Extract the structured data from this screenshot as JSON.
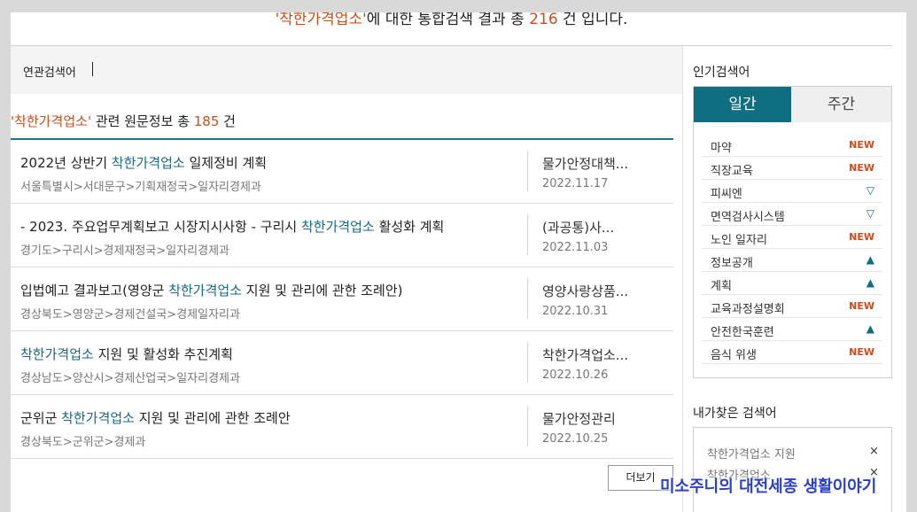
{
  "summary": {
    "quote_open": "'",
    "keyword": "착한가격업소",
    "quote_close": "'",
    "text_mid": "에 대한 통합검색 결과 총 ",
    "total": "216",
    "text_end": " 건 입니다."
  },
  "related": {
    "label": "연관검색어"
  },
  "count_line": {
    "quote_open": "'",
    "keyword": "착한가격업소",
    "quote_close": "'",
    "text_mid": " 관련 원문정보 총 ",
    "count": "185",
    "text_end": " 건"
  },
  "results": [
    {
      "pre": "2022년 상반기 ",
      "hl": "착한가격업소",
      "post": " 일제정비 계획",
      "path": "서울특별시>서대문구>기획재정국>일자리경제과",
      "org": "물가안정대책...",
      "date": "2022.11.17"
    },
    {
      "pre": "- 2023. 주요업무계획보고 시장지시사항 - 구리시 ",
      "hl": "착한가격업소",
      "post": " 활성화 계획",
      "path": "경기도>구리시>경제재정국>일자리경제과",
      "org": "(과공통)사...",
      "date": "2022.11.03"
    },
    {
      "pre": "입법예고 결과보고(영양군 ",
      "hl": "착한가격업소",
      "post": " 지원 및 관리에 관한 조례안)",
      "path": "경상북도>영양군>경제건설국>경제일자리과",
      "org": "영양사랑상품...",
      "date": "2022.10.31"
    },
    {
      "pre": "",
      "hl": "착한가격업소",
      "post": " 지원 및 활성화 추진계획",
      "path": "경상남도>양산시>경제산업국>일자리경제과",
      "org": "착한가격업소...",
      "date": "2022.10.26"
    },
    {
      "pre": "군위군 ",
      "hl": "착한가격업소",
      "post": " 지원 및 관리에 관한 조례안",
      "path": "경상북도>군위군>경제과",
      "org": "물가안정관리",
      "date": "2022.10.25"
    }
  ],
  "more_button": "더보기",
  "popular": {
    "title": "인기검색어",
    "tab_daily": "일간",
    "tab_weekly": "주간",
    "items": [
      {
        "name": "마약",
        "status": "NEW"
      },
      {
        "name": "직장교육",
        "status": "NEW"
      },
      {
        "name": "피씨엔",
        "status": "down"
      },
      {
        "name": "면역검사시스템",
        "status": "down"
      },
      {
        "name": "노인 일자리",
        "status": "NEW"
      },
      {
        "name": "정보공개",
        "status": "up"
      },
      {
        "name": "계획",
        "status": "up"
      },
      {
        "name": "교육과정설명회",
        "status": "NEW"
      },
      {
        "name": "안전한국훈련",
        "status": "up"
      },
      {
        "name": "음식 위생",
        "status": "NEW"
      }
    ],
    "status_glyphs": {
      "up": "▲",
      "down": "▽"
    },
    "status_colors": {
      "new": "#d24a1c",
      "up": "#0f6f80",
      "down": "#2a5ba8"
    }
  },
  "my_searches": {
    "title": "내가찾은 검색어",
    "items": [
      "착한가격업소 지원",
      "착한가격업소"
    ],
    "remove_glyph": "×"
  },
  "watermark": "미소주니의 대전세종 생활이야기",
  "colors": {
    "accent": "#0f6f80",
    "keyword": "#c8501e",
    "highlight": "#1a6a80"
  }
}
